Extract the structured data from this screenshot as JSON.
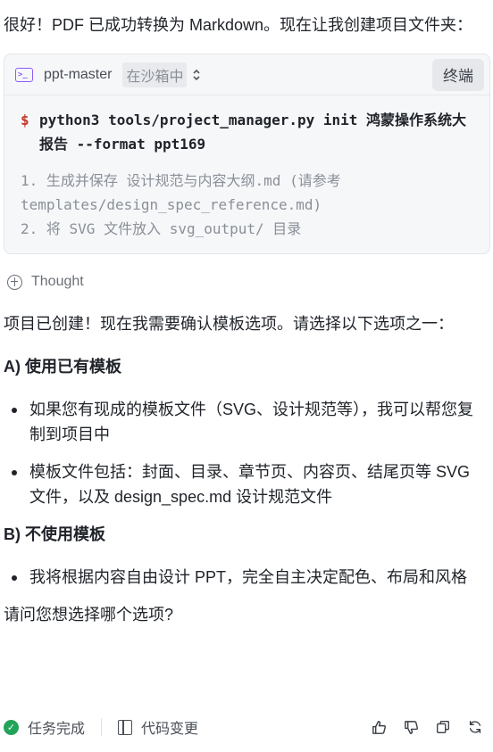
{
  "intro": "很好！PDF 已成功转换为 Markdown。现在让我创建项目文件夹：",
  "terminal": {
    "title": "ppt-master",
    "badge": "在沙箱中",
    "button": "终端",
    "prompt": "$",
    "command": "python3 tools/project_manager.py init 鸿蒙操作系统大报告 --format ppt169",
    "output": "1. 生成并保存 设计规范与内容大纲.md (请参考 templates/design_spec_reference.md)\n2. 将 SVG 文件放入 svg_output/ 目录"
  },
  "thought": {
    "label": "Thought"
  },
  "message": {
    "p1": "项目已创建！现在我需要确认模板选项。请选择以下选项之一：",
    "sectionA": {
      "title": "A) 使用已有模板",
      "items": [
        "如果您有现成的模板文件（SVG、设计规范等），我可以帮您复制到项目中",
        "模板文件包括：封面、目录、章节页、内容页、结尾页等 SVG 文件，以及 design_spec.md 设计规范文件"
      ]
    },
    "sectionB": {
      "title": "B) 不使用模板",
      "items": [
        "我将根据内容自由设计 PPT，完全自主决定配色、布局和风格"
      ]
    },
    "question": "请问您想选择哪个选项?"
  },
  "footer": {
    "status": "任务完成",
    "code_changes": "代码变更",
    "icons": [
      "thumbs-up-icon",
      "thumbs-down-icon",
      "copy-icon",
      "refresh-icon"
    ]
  }
}
